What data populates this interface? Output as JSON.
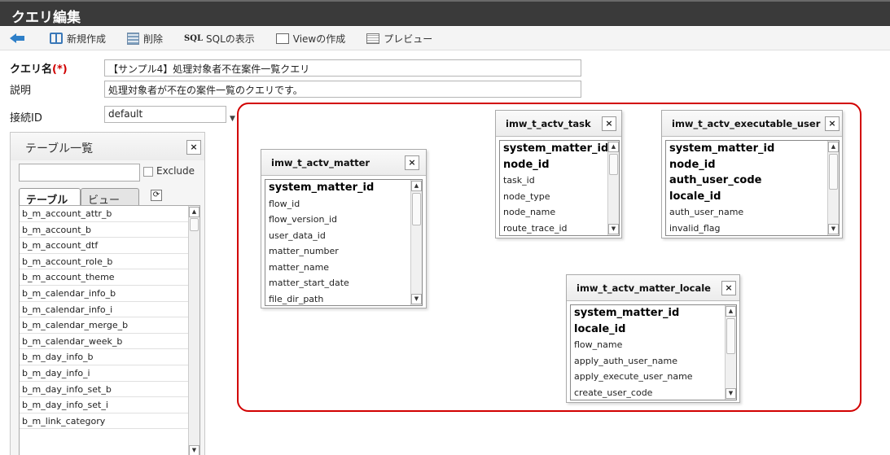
{
  "window": {
    "title": "クエリ編集"
  },
  "toolbar": {
    "new_label": "新規作成",
    "delete_label": "削除",
    "sql_icon_text": "SQL",
    "sql_label": "SQLの表示",
    "view_label": "Viewの作成",
    "preview_label": "プレビュー"
  },
  "form": {
    "name_label": "クエリ名",
    "required_mark": "(*)",
    "name_value": "【サンプル4】処理対象者不在案件一覧クエリ",
    "desc_label": "説明",
    "desc_value": "処理対象者が不在の案件一覧のクエリです。",
    "conn_label": "接続ID",
    "conn_value": "default",
    "select_arrow": "▼"
  },
  "table_list": {
    "title": "テーブル一覧",
    "close": "×",
    "search_value": "",
    "exclude_label": "Exclude",
    "tab_table": "テーブル",
    "tab_view": "ビュー",
    "refresh": "⟳",
    "items": [
      "b_m_account_attr_b",
      "b_m_account_b",
      "b_m_account_dtf",
      "b_m_account_role_b",
      "b_m_account_theme",
      "b_m_calendar_info_b",
      "b_m_calendar_info_i",
      "b_m_calendar_merge_b",
      "b_m_calendar_week_b",
      "b_m_day_info_b",
      "b_m_day_info_i",
      "b_m_day_info_set_b",
      "b_m_day_info_set_i",
      "b_m_link_category"
    ]
  },
  "scroll": {
    "up": "▲",
    "down": "▼"
  },
  "entities": [
    {
      "title": "imw_t_actv_matter",
      "close": "×",
      "columns": [
        {
          "name": "system_matter_id",
          "pk": true
        },
        {
          "name": "flow_id",
          "pk": false
        },
        {
          "name": "flow_version_id",
          "pk": false
        },
        {
          "name": "user_data_id",
          "pk": false
        },
        {
          "name": "matter_number",
          "pk": false
        },
        {
          "name": "matter_name",
          "pk": false
        },
        {
          "name": "matter_start_date",
          "pk": false
        },
        {
          "name": "file_dir_path",
          "pk": false
        }
      ]
    },
    {
      "title": "imw_t_actv_task",
      "close": "×",
      "columns": [
        {
          "name": "system_matter_id",
          "pk": true
        },
        {
          "name": "node_id",
          "pk": true
        },
        {
          "name": "task_id",
          "pk": false
        },
        {
          "name": "node_type",
          "pk": false
        },
        {
          "name": "node_name",
          "pk": false
        },
        {
          "name": "route_trace_id",
          "pk": false
        }
      ]
    },
    {
      "title": "imw_t_actv_executable_user",
      "close": "×",
      "columns": [
        {
          "name": "system_matter_id",
          "pk": true
        },
        {
          "name": "node_id",
          "pk": true
        },
        {
          "name": "auth_user_code",
          "pk": true
        },
        {
          "name": "locale_id",
          "pk": true
        },
        {
          "name": "auth_user_name",
          "pk": false
        },
        {
          "name": "invalid_flag",
          "pk": false
        }
      ]
    },
    {
      "title": "imw_t_actv_matter_locale",
      "close": "×",
      "columns": [
        {
          "name": "system_matter_id",
          "pk": true
        },
        {
          "name": "locale_id",
          "pk": true
        },
        {
          "name": "flow_name",
          "pk": false
        },
        {
          "name": "apply_auth_user_name",
          "pk": false
        },
        {
          "name": "apply_execute_user_name",
          "pk": false
        },
        {
          "name": "create_user_code",
          "pk": false
        }
      ]
    }
  ]
}
